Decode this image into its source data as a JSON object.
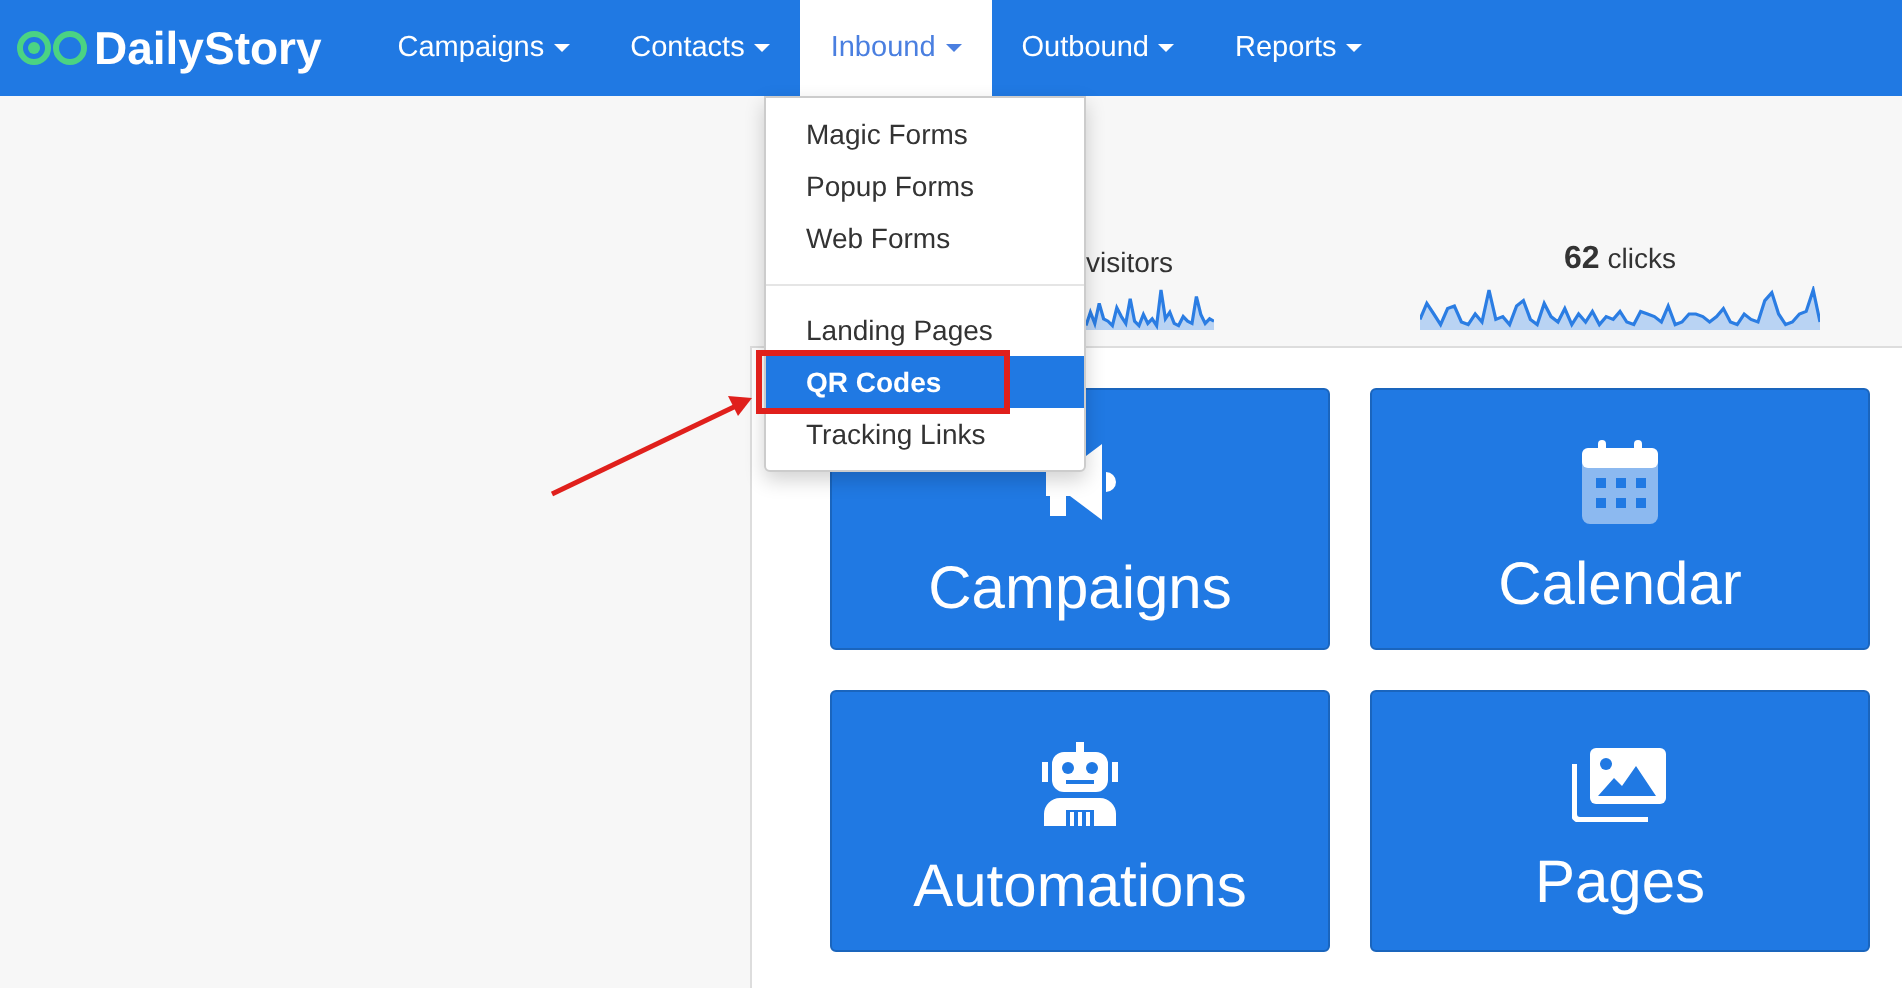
{
  "navbar": {
    "brand": "DailyStory",
    "items": [
      {
        "label": "Campaigns",
        "selected": false
      },
      {
        "label": "Contacts",
        "selected": false
      },
      {
        "label": "Inbound",
        "selected": true
      },
      {
        "label": "Outbound",
        "selected": false
      },
      {
        "label": "Reports",
        "selected": false
      }
    ]
  },
  "dropdown": {
    "groups": [
      [
        {
          "label": "Magic Forms",
          "selected": false
        },
        {
          "label": "Popup Forms",
          "selected": false
        },
        {
          "label": "Web Forms",
          "selected": false
        }
      ],
      [
        {
          "label": "Landing Pages",
          "selected": false
        },
        {
          "label": "QR Codes",
          "selected": true
        },
        {
          "label": "Tracking Links",
          "selected": false
        }
      ]
    ]
  },
  "stats": [
    {
      "label": "visitors"
    },
    {
      "value": "62",
      "label": "clicks"
    }
  ],
  "tiles": [
    {
      "label": "Campaigns",
      "kind": "megaphone"
    },
    {
      "label": "Calendar",
      "kind": "calendar"
    },
    {
      "label": "Automations",
      "kind": "robot"
    },
    {
      "label": "Pages",
      "kind": "images"
    }
  ]
}
